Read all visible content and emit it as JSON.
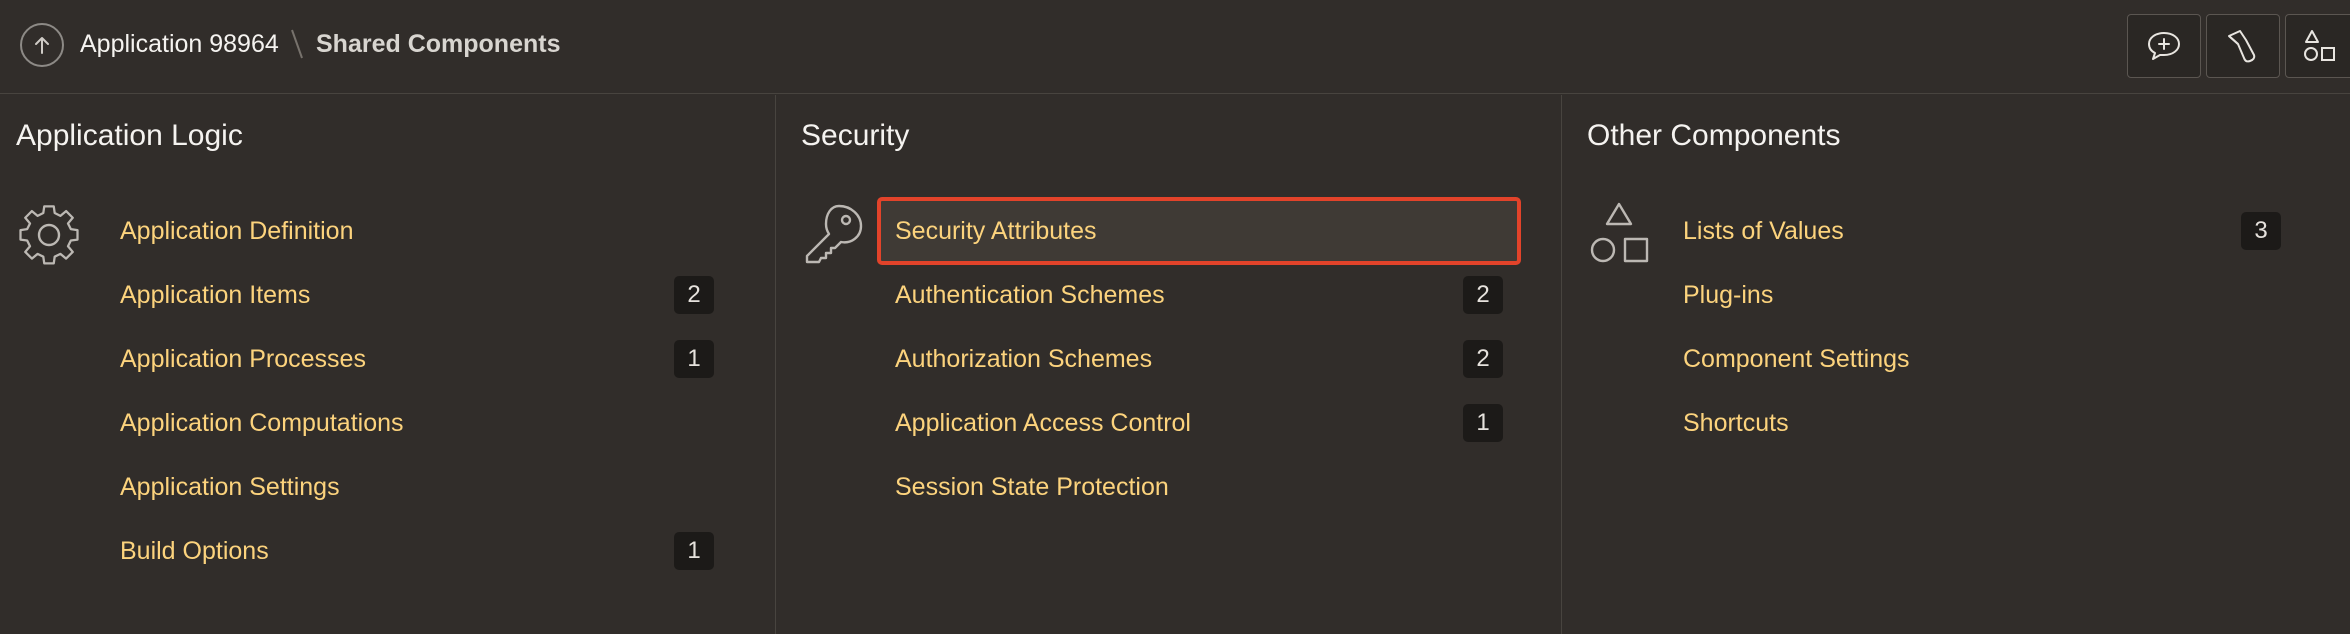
{
  "header": {
    "app_name": "Application 98964",
    "current_page": "Shared Components",
    "icons": [
      "arrow-up-icon",
      "chat-plus-icon",
      "flashlight-icon",
      "shapes-icon"
    ]
  },
  "columns": [
    {
      "title": "Application Logic",
      "icon": "gear-icon",
      "items": [
        {
          "label": "Application Definition",
          "count": ""
        },
        {
          "label": "Application Items",
          "count": "2"
        },
        {
          "label": "Application Processes",
          "count": "1"
        },
        {
          "label": "Application Computations",
          "count": ""
        },
        {
          "label": "Application Settings",
          "count": ""
        },
        {
          "label": "Build Options",
          "count": "1"
        }
      ]
    },
    {
      "title": "Security",
      "icon": "key-icon",
      "items": [
        {
          "label": "Security Attributes",
          "count": "",
          "selected": true
        },
        {
          "label": "Authentication Schemes",
          "count": "2"
        },
        {
          "label": "Authorization Schemes",
          "count": "2"
        },
        {
          "label": "Application Access Control",
          "count": "1"
        },
        {
          "label": "Session State Protection",
          "count": ""
        }
      ]
    },
    {
      "title": "Other Components",
      "icon": "shapes-icon",
      "items": [
        {
          "label": "Lists of Values",
          "count": "3"
        },
        {
          "label": "Plug-ins",
          "count": ""
        },
        {
          "label": "Component Settings",
          "count": ""
        },
        {
          "label": "Shortcuts",
          "count": ""
        }
      ]
    }
  ],
  "colors": {
    "background": "#312d2a",
    "link": "#fcd37d",
    "selection_outline": "#e2432a",
    "badge_bg": "#1c1a18"
  }
}
